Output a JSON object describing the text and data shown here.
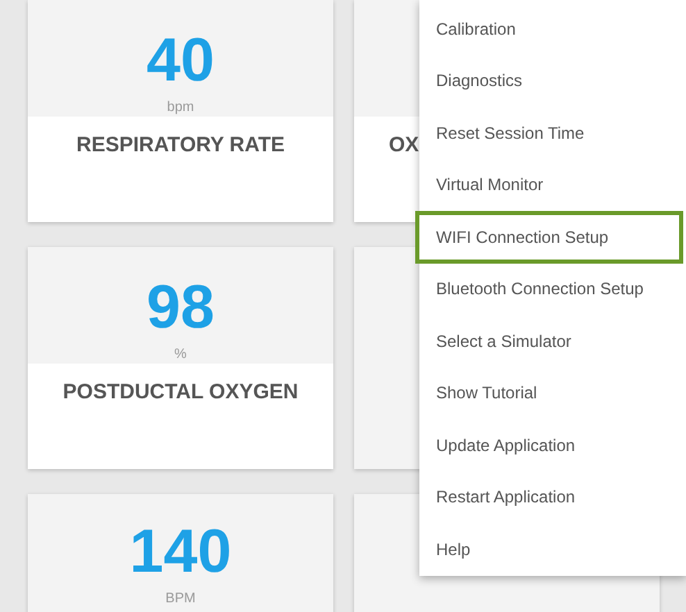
{
  "cards": [
    {
      "kind": "vital",
      "value": "40",
      "unit": "bpm",
      "label": "RESPIRATORY RATE"
    },
    {
      "kind": "vital",
      "label": "OX"
    },
    {
      "kind": "vital",
      "value": "98",
      "unit": "%",
      "label": "POSTDUCTAL OXYGEN"
    },
    {
      "kind": "blank"
    },
    {
      "kind": "vital",
      "value": "140",
      "unit": "BPM"
    },
    {
      "kind": "blank"
    }
  ],
  "menu": {
    "items": [
      {
        "label": "Calibration",
        "selected": false
      },
      {
        "label": "Diagnostics",
        "selected": false
      },
      {
        "label": "Reset Session Time",
        "selected": false
      },
      {
        "label": "Virtual Monitor",
        "selected": false
      },
      {
        "label": "WIFI Connection Setup",
        "selected": true
      },
      {
        "label": "Bluetooth Connection Setup",
        "selected": false
      },
      {
        "label": "Select a Simulator",
        "selected": false
      },
      {
        "label": "Show Tutorial",
        "selected": false
      },
      {
        "label": "Update Application",
        "selected": false
      },
      {
        "label": "Restart Application",
        "selected": false
      },
      {
        "label": "Help",
        "selected": false
      }
    ]
  }
}
